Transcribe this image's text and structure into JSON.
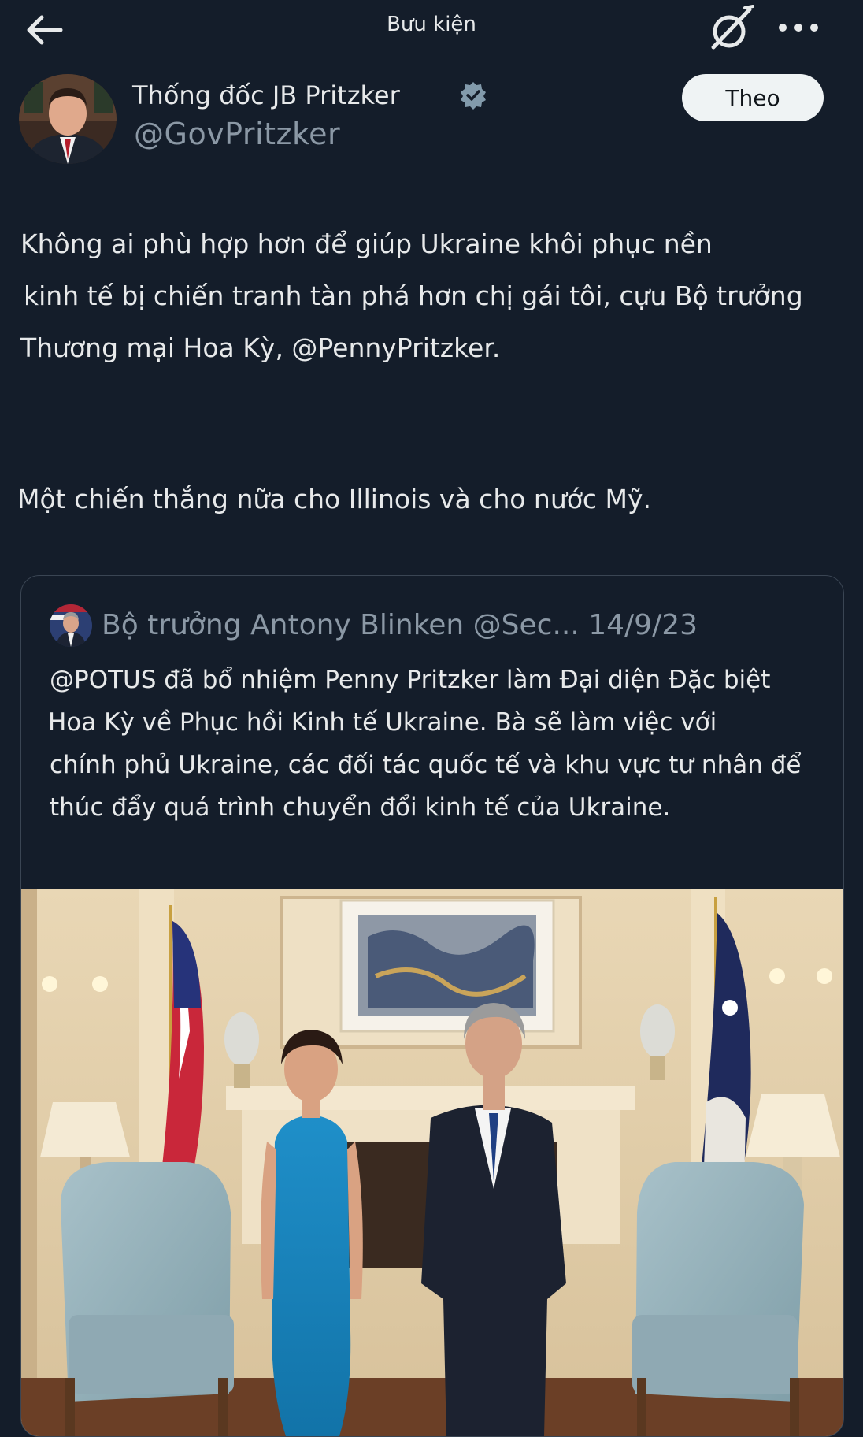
{
  "header": {
    "title": "Bưu kiện",
    "back_icon": "arrow-left-icon",
    "grok_icon": "grok-icon",
    "more_icon": "more-horizontal-icon"
  },
  "author": {
    "display_name": "Thống đốc JB Pritzker",
    "handle": "@GovPritzker",
    "verified_color": "#829aab",
    "follow_label": "Theo"
  },
  "tweet": {
    "lines": [
      "Không ai phù hợp hơn để giúp Ukraine khôi phục nền",
      "kinh tế bị chiến tranh tàn phá hơn chị gái tôi, cựu Bộ trưởng",
      "Thương mại Hoa Kỳ, @PennyPritzker.",
      "Một chiến thắng nữa cho Illinois và cho nước Mỹ."
    ]
  },
  "quote": {
    "header": "Bộ trưởng Antony Blinken @Sec... 14/9/23",
    "lines": [
      "@POTUS đã bổ nhiệm Penny Pritzker làm Đại diện Đặc biệt",
      "Hoa Kỳ về Phục hồi Kinh tế Ukraine. Bà sẽ làm việc với",
      "chính phủ Ukraine, các đối tác quốc tế và khu vực tư nhân để",
      "thúc đẩy quá trình chuyển đổi kinh tế của Ukraine."
    ]
  },
  "colors": {
    "background": "#141d2a",
    "text": "#e7e9ea",
    "secondary": "#8b98a5",
    "border": "#3a4553"
  }
}
